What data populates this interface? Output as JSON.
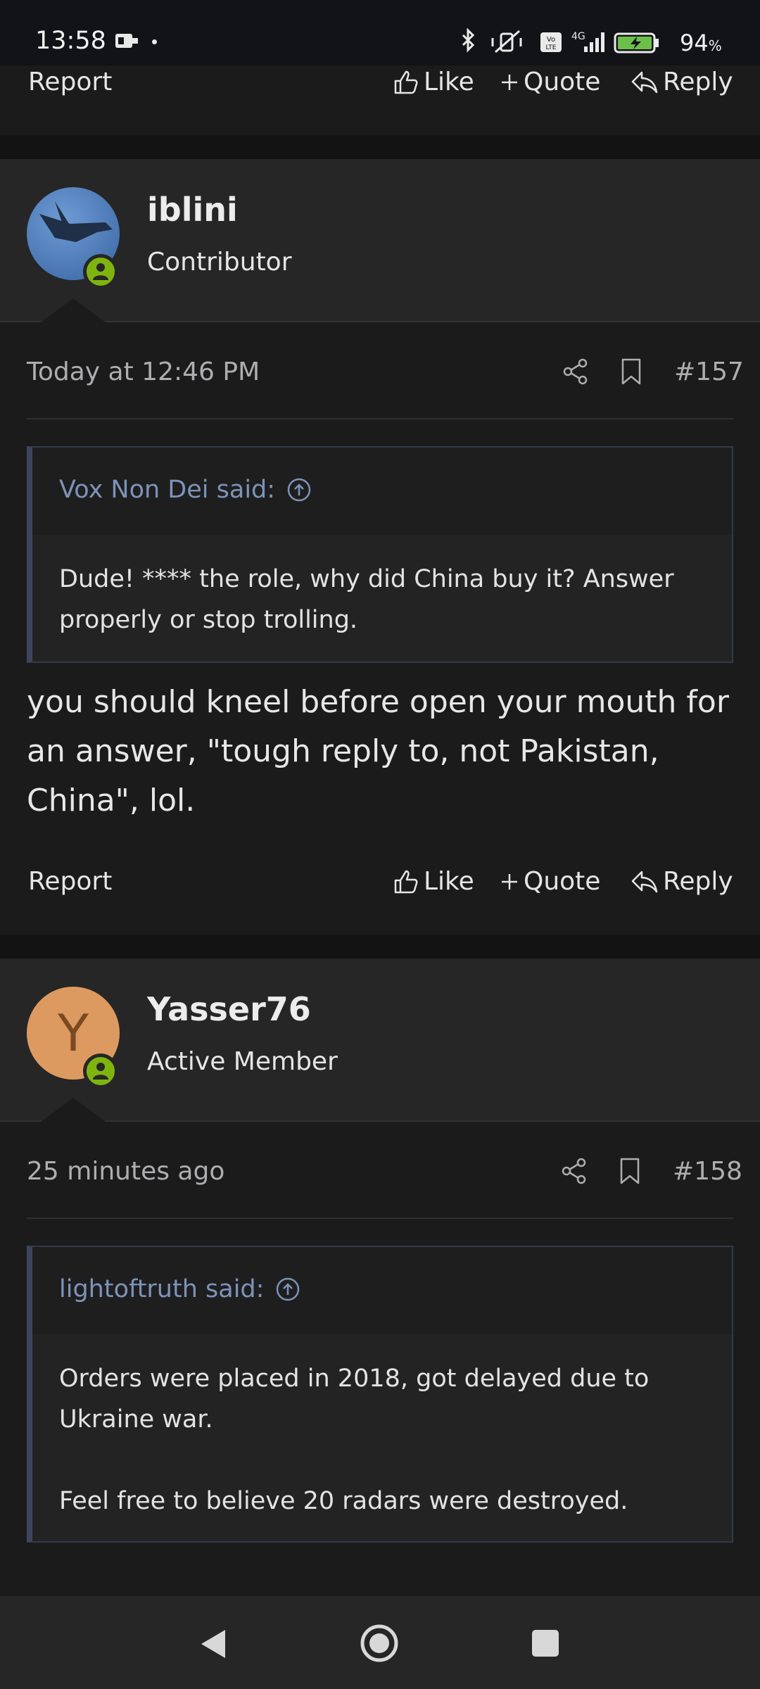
{
  "status_bar": {
    "time": "13:58",
    "battery_percent": "94",
    "battery_unit": "%",
    "network": "4G",
    "volte": "Vo LTE"
  },
  "actions": {
    "report": "Report",
    "like": "Like",
    "quote": "Quote",
    "reply": "Reply"
  },
  "posts": [
    {
      "username": "iblini",
      "user_title": "Contributor",
      "date": "Today at 12:46 PM",
      "post_number": "#157",
      "quote_author": "Vox Non Dei said:",
      "quote_paragraphs": [
        "Dude! **** the role, why did China buy it? Answer properly or stop trolling."
      ],
      "body": "you should kneel before open your mouth for an answer, \"tough reply to, not Pakistan, China\", lol."
    },
    {
      "username": "Yasser76",
      "user_title": "Active Member",
      "avatar_letter": "Y",
      "avatar_color": "#dd9a60",
      "date": "25 minutes ago",
      "post_number": "#158",
      "quote_author": "lightoftruth said:",
      "quote_paragraphs": [
        "Orders were placed in 2018, got delayed due to Ukraine war.",
        "",
        "Feel free to believe 20 radars were destroyed."
      ]
    }
  ],
  "colors": {
    "background": "#1b1b1c",
    "header_bg": "#262627",
    "quote_author": "#7d93b8",
    "online_indicator": "#7fb40f"
  }
}
